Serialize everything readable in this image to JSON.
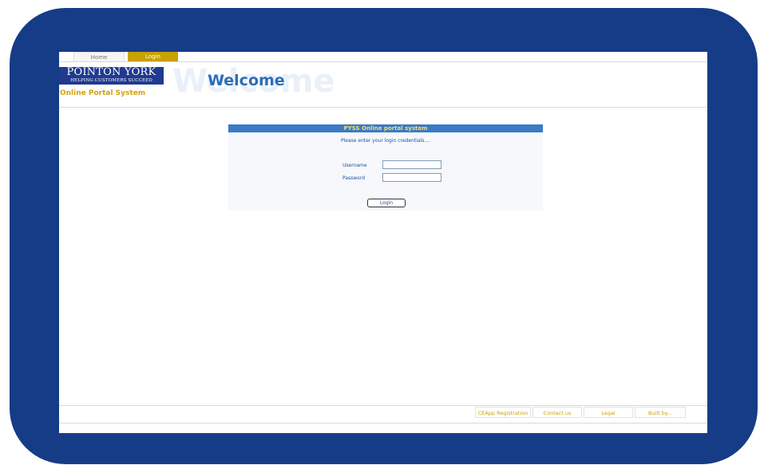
{
  "tabs": {
    "home": "Home",
    "login": "Login"
  },
  "brand": {
    "logo_main": "POINTON YORK",
    "logo_tagline": "HELPING CUSTOMERS SUCCEED",
    "portal_title": "Online Portal System"
  },
  "header": {
    "ghost": "Welcome",
    "title": "Welcome"
  },
  "login_panel": {
    "title": "PYSS Online portal system",
    "subtitle": "Please enter your login credentials....",
    "username_label": "Username",
    "password_label": "Password",
    "username_value": "",
    "password_value": "",
    "button_label": "Login"
  },
  "footer": {
    "links": [
      "CEApp Registration",
      "Contact us",
      "Legal",
      "Built by..."
    ]
  },
  "colors": {
    "frame": "#163c87",
    "accent_gold": "#c8a102",
    "title_blue": "#2b6db6",
    "panel_bar": "#3a7ac6"
  }
}
